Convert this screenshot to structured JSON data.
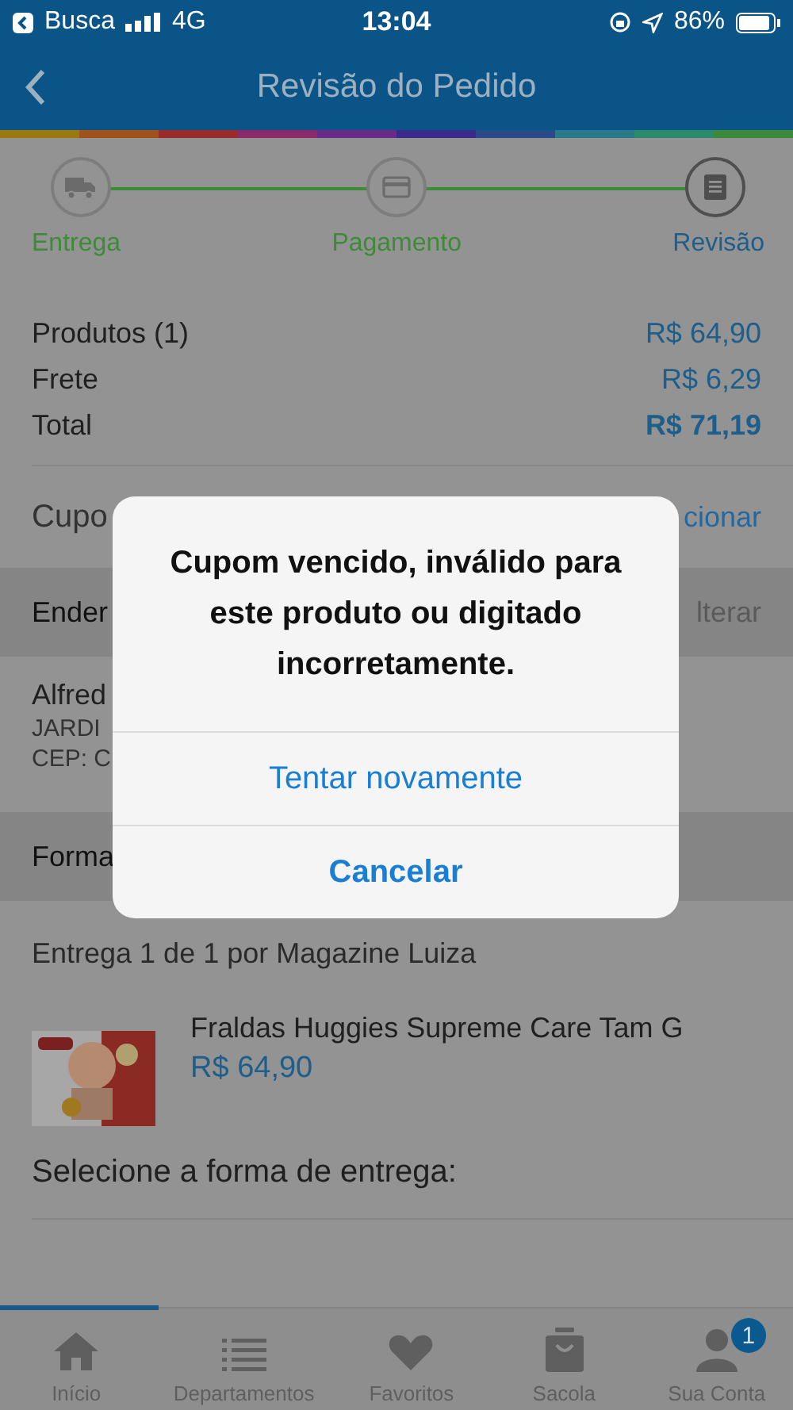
{
  "status_bar": {
    "back_app": "Busca",
    "network": "4G",
    "time": "13:04",
    "battery": "86%"
  },
  "nav": {
    "title": "Revisão do Pedido"
  },
  "steps": [
    {
      "label": "Entrega",
      "kind": "truck",
      "selected": false
    },
    {
      "label": "Pagamento",
      "kind": "card",
      "selected": false
    },
    {
      "label": "Revisão",
      "kind": "list",
      "selected": true
    }
  ],
  "summary": [
    {
      "label": "Produtos (1)",
      "value": "R$ 64,90",
      "bold": false
    },
    {
      "label": "Frete",
      "value": "R$ 6,29",
      "bold": false
    },
    {
      "label": "Total",
      "value": "R$ 71,19",
      "bold": true
    }
  ],
  "coupon": {
    "label": "Cupo",
    "action": "cionar"
  },
  "address": {
    "header": "Ender",
    "action": "lterar",
    "lines": [
      "Alfred",
      "JARDI",
      "CEP: C"
    ]
  },
  "payment": {
    "header": "Forma"
  },
  "delivery": {
    "title": "Entrega 1 de 1",
    "seller": "por Magazine Luiza"
  },
  "product": {
    "name": "Fraldas Huggies Supreme Care Tam G",
    "price": "R$ 64,90"
  },
  "select_delivery": "Selecione a forma de entrega:",
  "alert": {
    "message": "Cupom vencido, inválido para este produto ou digitado incorretamente.",
    "buttons": [
      {
        "label": "Tentar novamente",
        "bold": false
      },
      {
        "label": "Cancelar",
        "bold": true
      }
    ]
  },
  "tab_bar": [
    {
      "label": "Início",
      "kind": "home"
    },
    {
      "label": "Departamentos",
      "kind": "list"
    },
    {
      "label": "Favoritos",
      "kind": "heart"
    },
    {
      "label": "Sacola",
      "kind": "bag"
    },
    {
      "label": "Sua Conta",
      "kind": "person",
      "badge": "1"
    }
  ]
}
